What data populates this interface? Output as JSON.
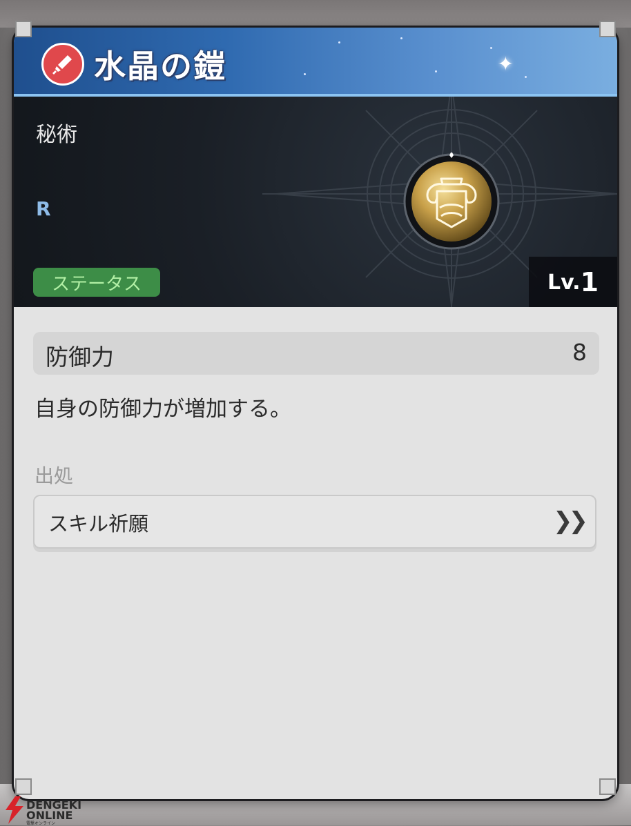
{
  "card": {
    "title": "水晶の鎧",
    "title_icon": "sword-icon",
    "category": "秘術",
    "rarity": "R",
    "tag": "ステータス",
    "level_prefix": "Lv.",
    "level": "1",
    "item_icon": "armor-icon"
  },
  "stat": {
    "label": "防御力",
    "value": "8"
  },
  "description": "自身の防御力が増加する。",
  "source": {
    "label": "出処",
    "item": "スキル祈願",
    "arrow_icon": "double-chevron-right-icon"
  },
  "watermark": {
    "line1": "DENGEKI",
    "line2": "ONLINE",
    "line3": "電撃オンライン"
  },
  "colors": {
    "title_bar": "#2f6ab0",
    "tag_bg": "#3d8d47",
    "tag_text": "#b3f0a6",
    "rarity": "#8fbce8",
    "title_icon_bg": "#e0484c"
  }
}
